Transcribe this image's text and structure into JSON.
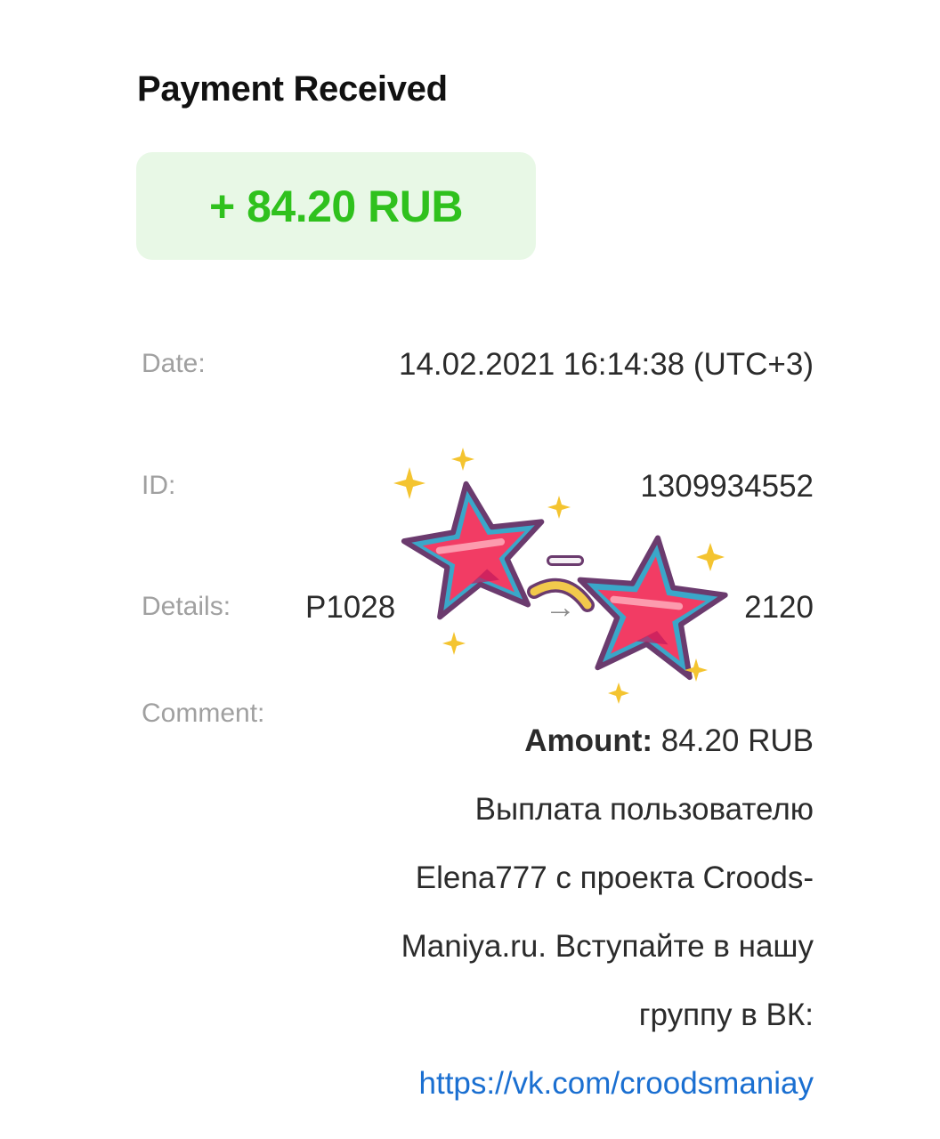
{
  "header": {
    "title": "Payment Received"
  },
  "amount": {
    "text": "+ 84.20 RUB",
    "color": "#2fc11d",
    "background": "#e8f8e6"
  },
  "details": {
    "date_label": "Date:",
    "date_value": "14.02.2021 16:14:38 (UTC+3)",
    "id_label": "ID:",
    "id_value": "1309934552",
    "details_label": "Details:",
    "details_value_left": "P1028",
    "details_value_arrow": "→",
    "details_value_right": "2120",
    "comment_label": "Comment:"
  },
  "comment": {
    "amount_label": "Amount:",
    "amount_value": " 84.20 RUB",
    "lines": [
      "Выплата пользователю",
      "Elena777 с проекта Croods-",
      "Maniya.ru. Вступайте в нашу",
      "группу в ВК:"
    ],
    "link": "https://vk.com/croodsmaniay",
    "link_color": "#1a6fd1"
  },
  "sticker": {
    "icon": "star-sunglasses-sticker-icon"
  }
}
